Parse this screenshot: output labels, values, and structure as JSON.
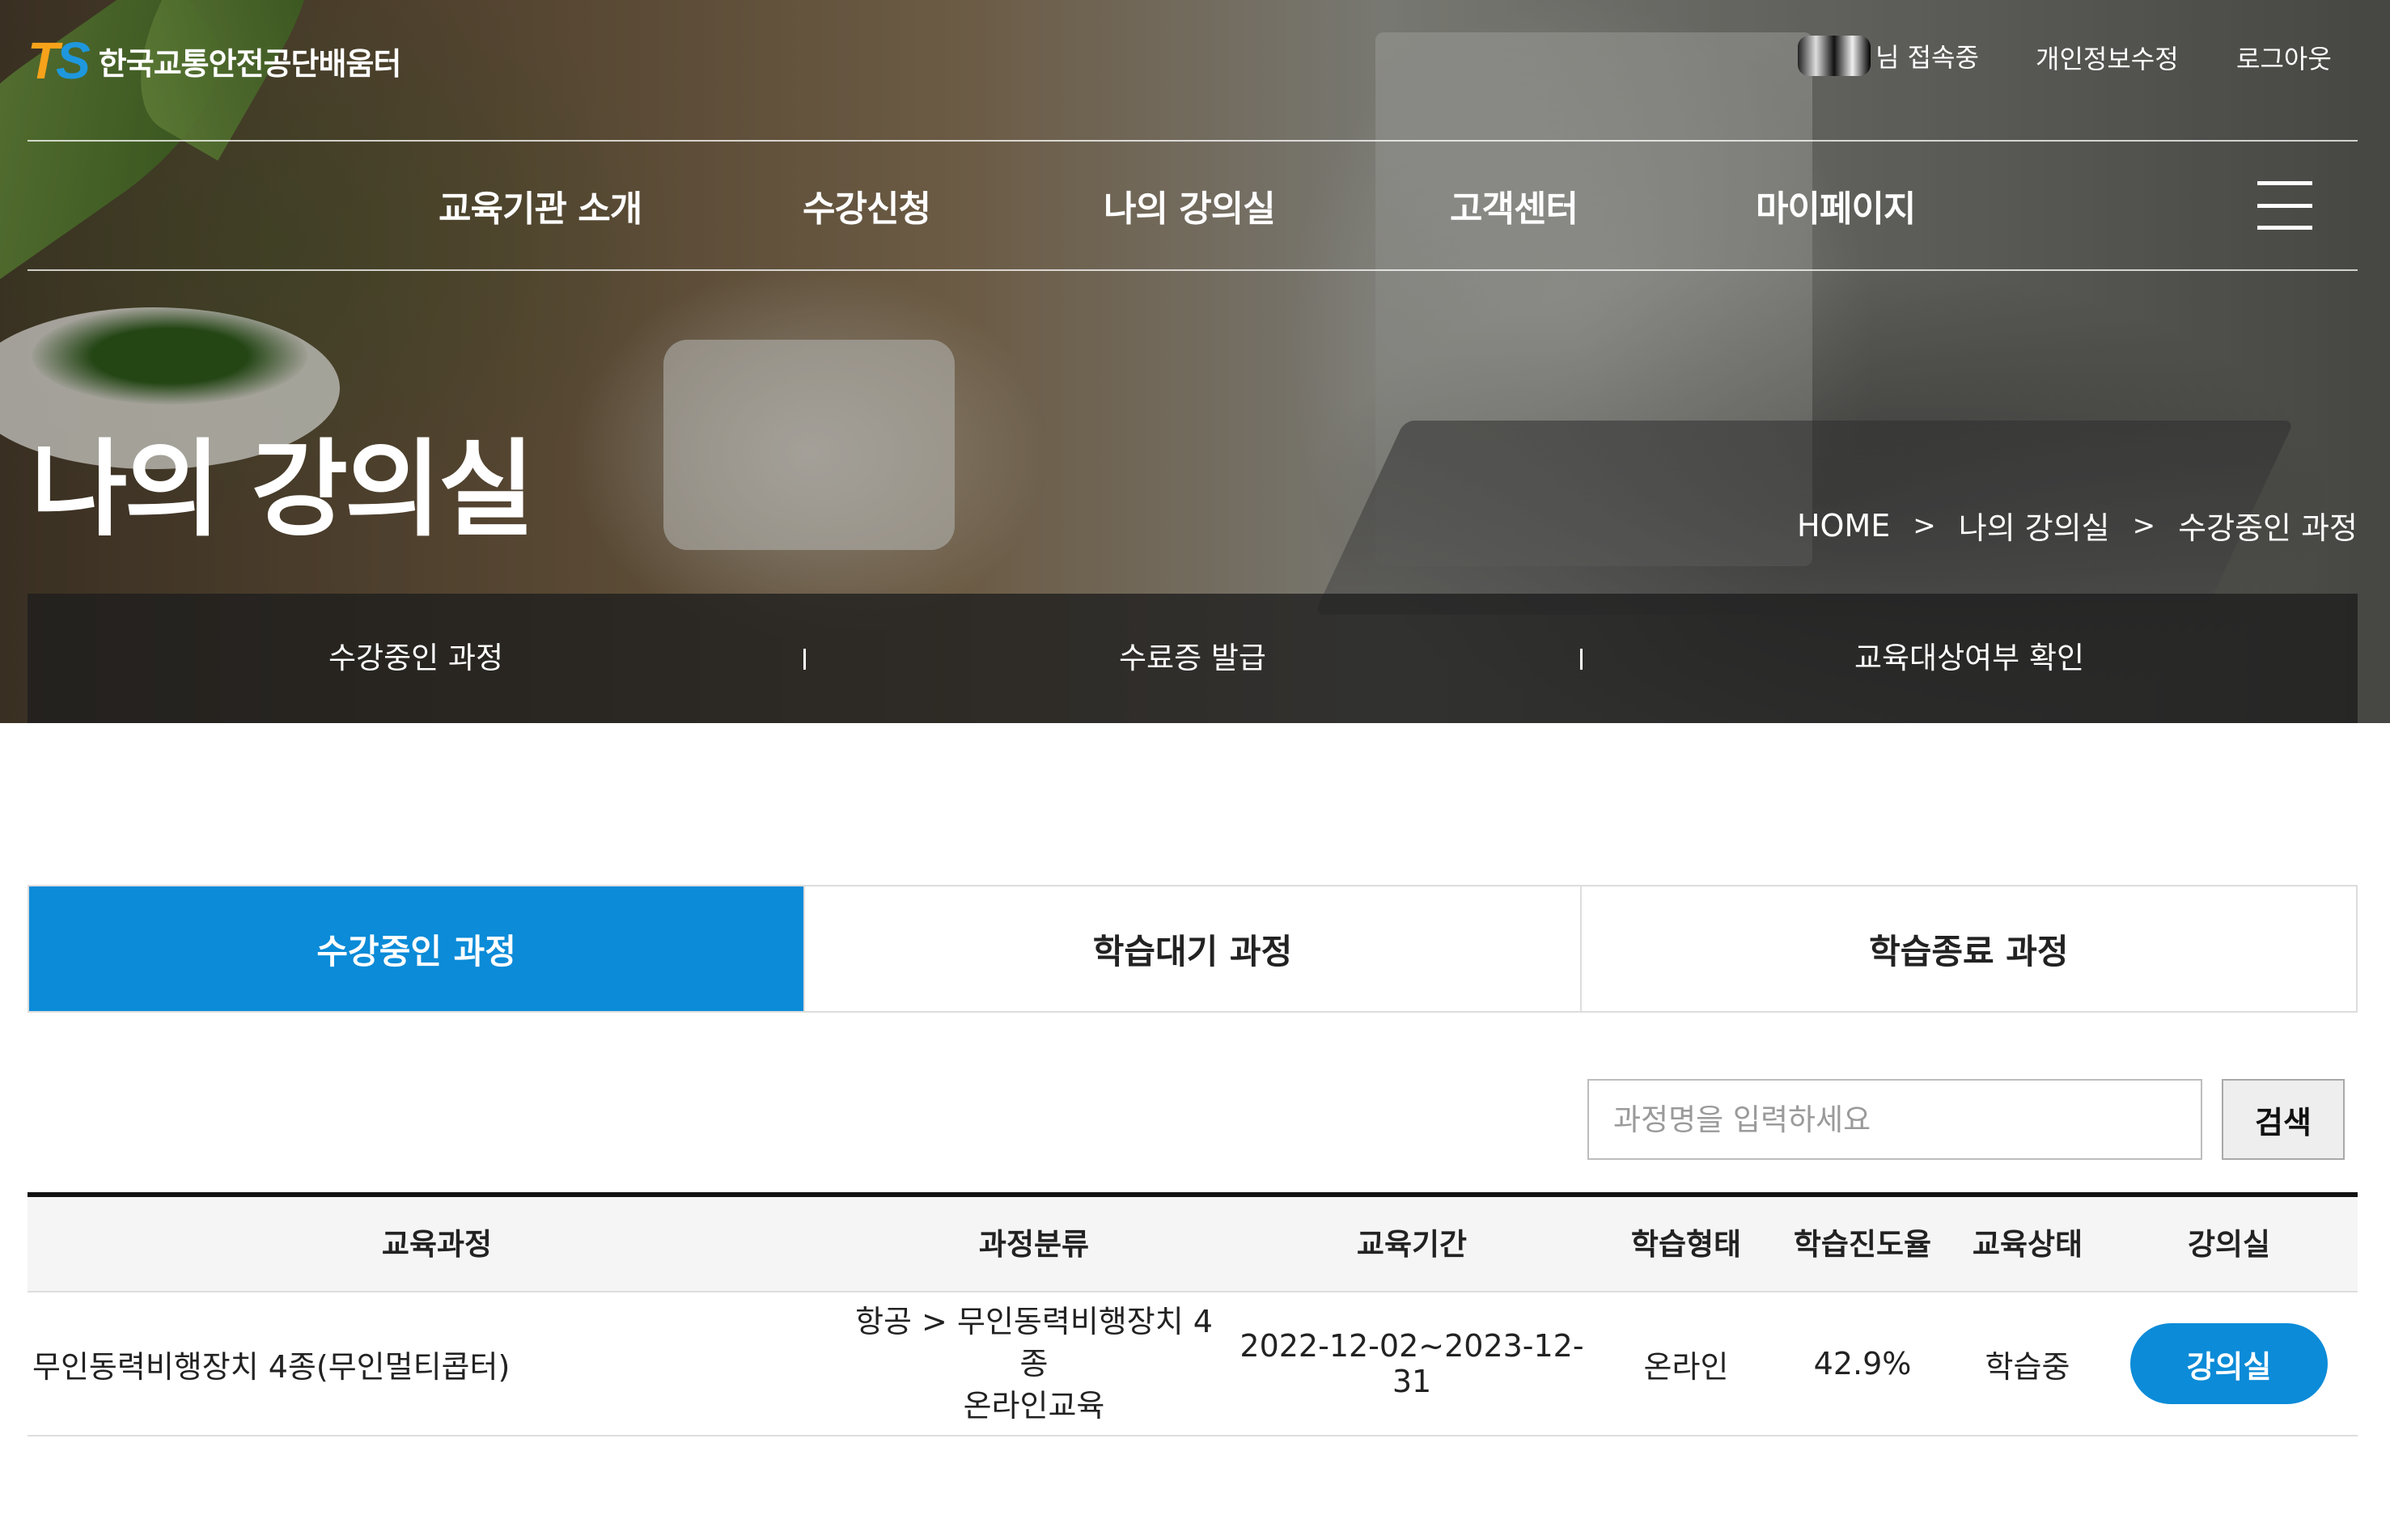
{
  "header": {
    "logo_mark_t": "T",
    "logo_mark_s": "S",
    "logo_text": "한국교통안전공단배움터",
    "user_status": "님 접속중",
    "edit_profile": "개인정보수정",
    "logout": "로그아웃"
  },
  "gnb": [
    {
      "label": "교육기관 소개"
    },
    {
      "label": "수강신청"
    },
    {
      "label": "나의 강의실"
    },
    {
      "label": "고객센터"
    },
    {
      "label": "마이페이지"
    }
  ],
  "hero": {
    "title": "나의 강의실",
    "breadcrumb": [
      "HOME",
      "나의 강의실",
      "수강중인 과정"
    ]
  },
  "subnav": [
    "수강중인 과정",
    "수료증 발급",
    "교육대상여부 확인"
  ],
  "tabs": [
    "수강중인 과정",
    "학습대기 과정",
    "학습종료 과정"
  ],
  "active_tab": 0,
  "search": {
    "placeholder": "과정명을 입력하세요",
    "button": "검색"
  },
  "table": {
    "columns": [
      "교육과정",
      "과정분류",
      "교육기간",
      "학습형태",
      "학습진도율",
      "교육상태",
      "강의실"
    ],
    "rows": [
      {
        "course": "무인동력비행장치 4종(무인멀티콥터)",
        "category_line1": "항공 > 무인동력비행장치 4종",
        "category_line2": "온라인교육",
        "period": "2022-12-02~2023-12-31",
        "type": "온라인",
        "progress": "42.9%",
        "status": "학습중",
        "action": "강의실"
      }
    ]
  },
  "colors": {
    "accent": "#0b8bd8",
    "logo_orange": "#f6a21a",
    "logo_blue": "#1e97dd"
  }
}
